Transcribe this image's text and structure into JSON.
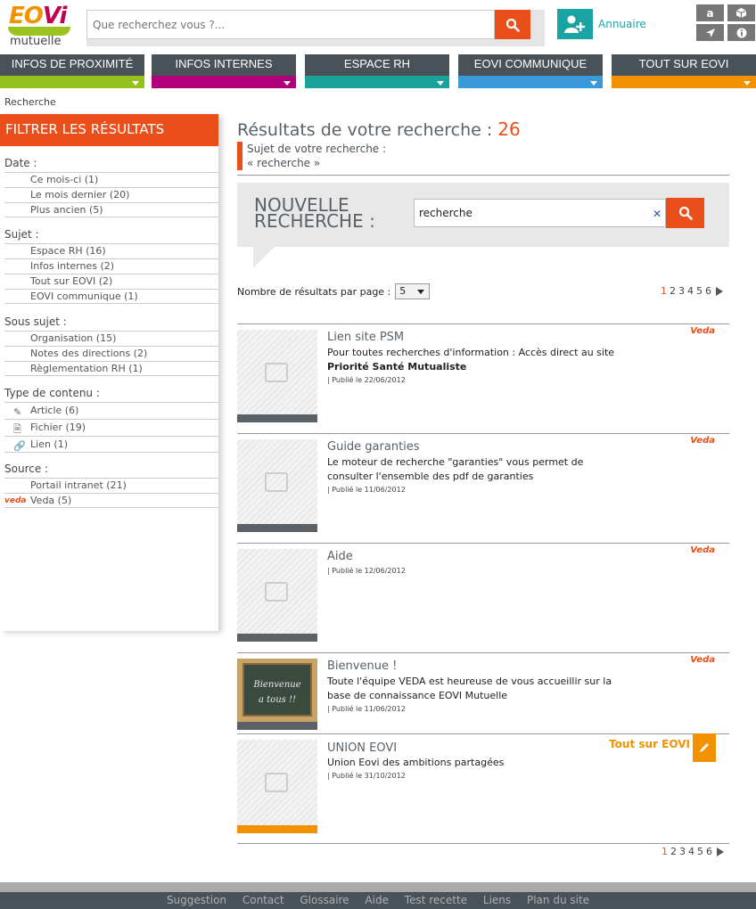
{
  "logo": {
    "text1": "EO",
    "text2": "Vi",
    "sub": "mutuelle"
  },
  "search": {
    "placeholder": "Que recherchez vous ?..."
  },
  "annuaire": {
    "label": "Annuaire"
  },
  "toolbar": {
    "font_label": "a"
  },
  "nav": [
    {
      "label": "Infos de proximité",
      "color": "#95c11f"
    },
    {
      "label": "Infos internes",
      "color": "#b0007a"
    },
    {
      "label": "Espace RH",
      "color": "#19a39a"
    },
    {
      "label": "EOVI communique",
      "color": "#3a9ad9"
    },
    {
      "label": "Tout sur EOVI",
      "color": "#f39200"
    }
  ],
  "breadcrumb": "Recherche",
  "filters": {
    "title": "FILTRER LES RÉSULTATS",
    "groups": [
      {
        "title": "Date :",
        "items": [
          "Ce mois-ci  (1)",
          "Le mois dernier  (20)",
          "Plus ancien  (5)"
        ]
      },
      {
        "title": "Sujet :",
        "items": [
          "Espace RH  (16)",
          "Infos internes  (2)",
          "Tout sur EOVI  (2)",
          "EOVI communique  (1)"
        ]
      },
      {
        "title": "Sous sujet :",
        "items": [
          "Organisation  (15)",
          "Notes des directions  (2)",
          "Règlementation RH  (1)"
        ]
      },
      {
        "title": "Type de contenu :",
        "items": [
          "Article  (6)",
          "Fichier  (19)",
          "Lien  (1)"
        ]
      },
      {
        "title": "Source :",
        "items": [
          "Portail intranet  (21)",
          "Veda  (5)"
        ]
      }
    ]
  },
  "results": {
    "title": "Résultats de votre recherche : ",
    "count": "26",
    "subject_label": "Sujet de votre recherche :",
    "subject_value": "« recherche »",
    "new_search_line1": "Nouvelle",
    "new_search_line2": "recherche :",
    "query": "recherche",
    "per_page_label": "Nombre de résultats par page :",
    "per_page_value": "5",
    "pages": [
      "1",
      "2",
      "3",
      "4",
      "5",
      "6"
    ],
    "items": [
      {
        "title": "Lien site PSM",
        "desc": "Pour toutes recherches d'information : Accès direct au site",
        "desc_bold": "Priorité Santé Mutualiste",
        "date": "| Publié le 22/06/2012",
        "source": "Veda"
      },
      {
        "title": "Guide garanties",
        "desc": "Le moteur de recherche \"garanties\" vous permet de consulter l'ensemble des pdf de garanties",
        "desc_bold": "",
        "date": "| Publié le 11/06/2012",
        "source": "Veda"
      },
      {
        "title": "Aide",
        "desc": "",
        "desc_bold": "",
        "date": "| Publié le 12/06/2012",
        "source": "Veda"
      },
      {
        "title": "Bienvenue !",
        "desc": "Toute l'équipe VEDA est heureuse de vous accueillir sur la base de connaissance EOVI Mutuelle",
        "desc_bold": "",
        "date": "| Publié le 11/06/2012",
        "source": "Veda",
        "thumb_line1": "Bienvenue",
        "thumb_line2": "a tous !!"
      },
      {
        "title": "UNION EOVI",
        "desc": "Union Eovi des ambitions partagées",
        "desc_bold": "",
        "date": "| Publié le 31/10/2012",
        "source": "Tout sur EOVI"
      }
    ]
  },
  "footer": [
    "Suggestion",
    "Contact",
    "Glossaire",
    "Aide",
    "Test recette",
    "Liens",
    "Plan du site"
  ]
}
